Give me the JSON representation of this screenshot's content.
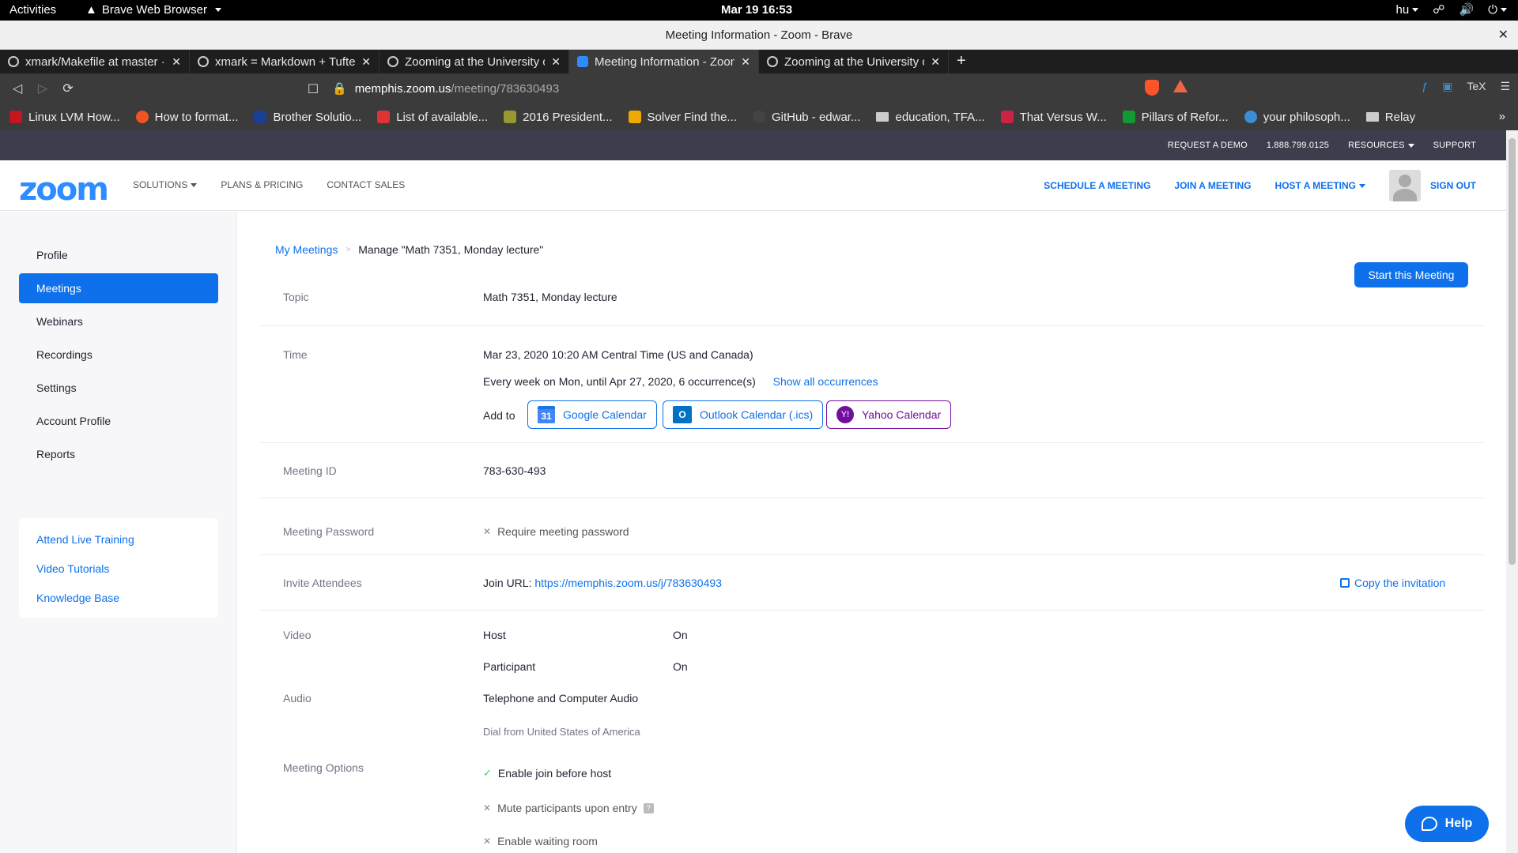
{
  "system": {
    "activities": "Activities",
    "app_name": "Brave Web Browser",
    "clock": "Mar 19  16:53",
    "keyboard": "hu"
  },
  "window": {
    "title": "Meeting Information - Zoom - Brave"
  },
  "tabs": [
    {
      "label": "xmark/Makefile at master · edwardtufte"
    },
    {
      "label": "xmark = Markdown + Tufte"
    },
    {
      "label": "Zooming at the University of Memphis"
    },
    {
      "label": "Meeting Information - Zoom"
    },
    {
      "label": "Zooming at the University of Memphis"
    }
  ],
  "address": {
    "host": "memphis.zoom.us",
    "path": "/meeting/783630493",
    "shield_count": "3",
    "alert_count": "4"
  },
  "bookmarks": [
    {
      "label": "Linux LVM How...",
      "color": "#c4161c"
    },
    {
      "label": "How to format...",
      "color": "#ee5522"
    },
    {
      "label": "Brother Solutio...",
      "color": "#1c3f94"
    },
    {
      "label": "List of available...",
      "color": "#dd3333"
    },
    {
      "label": "2016 President...",
      "color": "#999933"
    },
    {
      "label": "Solver Find the...",
      "color": "#eeaa00"
    },
    {
      "label": "GitHub - edwar...",
      "color": "#444444"
    },
    {
      "label": "education, TFA...",
      "folder": true
    },
    {
      "label": "That Versus W...",
      "color": "#cc2244"
    },
    {
      "label": "Pillars of Refor...",
      "color": "#119933"
    },
    {
      "label": "your philosoph...",
      "color": "#3b8ed6"
    },
    {
      "label": "Relay",
      "folder": true
    }
  ],
  "util_bar": {
    "request_demo": "REQUEST A DEMO",
    "phone": "1.888.799.0125",
    "resources": "RESOURCES",
    "support": "SUPPORT"
  },
  "main_nav": {
    "logo": "zoom",
    "solutions": "SOLUTIONS",
    "plans": "PLANS & PRICING",
    "contact": "CONTACT SALES",
    "schedule": "SCHEDULE A MEETING",
    "join": "JOIN A MEETING",
    "host": "HOST A MEETING",
    "signout": "SIGN OUT"
  },
  "sidebar": {
    "items": [
      {
        "label": "Profile"
      },
      {
        "label": "Meetings",
        "active": true
      },
      {
        "label": "Webinars"
      },
      {
        "label": "Recordings"
      },
      {
        "label": "Settings"
      },
      {
        "label": "Account Profile"
      },
      {
        "label": "Reports"
      }
    ],
    "help_links": [
      {
        "label": "Attend Live Training"
      },
      {
        "label": "Video Tutorials"
      },
      {
        "label": "Knowledge Base"
      }
    ]
  },
  "breadcrumb": {
    "parent": "My Meetings",
    "current": "Manage \"Math 7351, Monday lecture\""
  },
  "start_button": "Start this Meeting",
  "meeting": {
    "topic_label": "Topic",
    "topic": "Math 7351, Monday lecture",
    "time_label": "Time",
    "time": "Mar 23, 2020 10:20 AM Central Time (US and Canada)",
    "recurrence": "Every week on Mon, until Apr 27, 2020, 6 occurrence(s)",
    "show_all": "Show all occurrences",
    "add_to": "Add to",
    "google_cal": "Google Calendar",
    "outlook_cal": "Outlook Calendar (.ics)",
    "yahoo_cal": "Yahoo Calendar",
    "id_label": "Meeting ID",
    "id": "783-630-493",
    "password_label": "Meeting Password",
    "password_opt": "Require meeting password",
    "invite_label": "Invite Attendees",
    "join_url_label": "Join URL:",
    "join_url": "https://memphis.zoom.us/j/783630493",
    "copy_invitation": "Copy the invitation",
    "video_label": "Video",
    "host_label": "Host",
    "host_val": "On",
    "participant_label": "Participant",
    "participant_val": "On",
    "audio_label": "Audio",
    "audio_val": "Telephone and Computer Audio",
    "dial_from": "Dial from United States of America",
    "options_label": "Meeting Options",
    "opt_join_before": "Enable join before host",
    "opt_mute": "Mute participants upon entry",
    "opt_waiting": "Enable waiting room"
  },
  "help_button": "Help"
}
